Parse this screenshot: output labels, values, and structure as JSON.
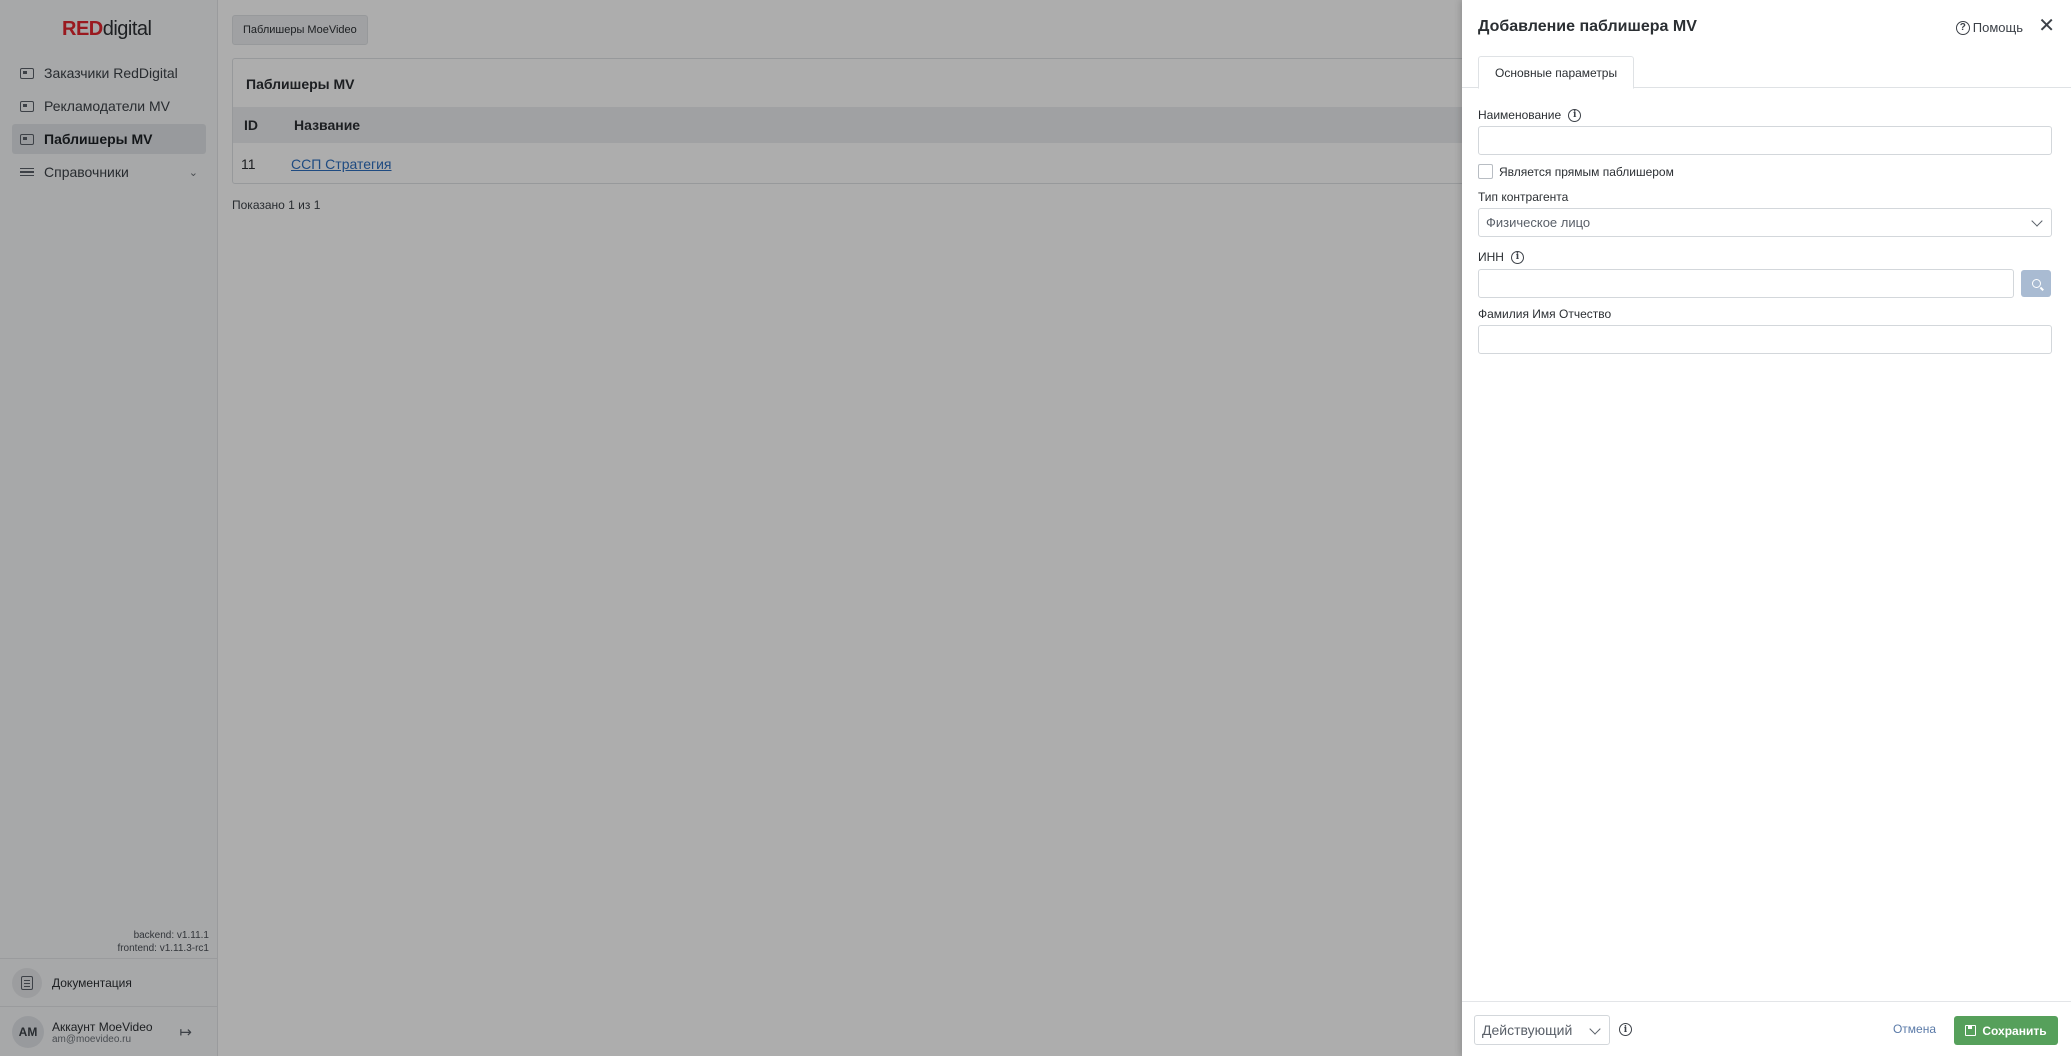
{
  "logo": {
    "red": "RED",
    "digital": "digital"
  },
  "sidebar": {
    "items": [
      {
        "label": "Заказчики RedDigital",
        "icon": "card-icon"
      },
      {
        "label": "Рекламодатели MV",
        "icon": "card-icon"
      },
      {
        "label": "Паблишеры MV",
        "icon": "card-icon",
        "active": true
      },
      {
        "label": "Справочники",
        "icon": "list-icon",
        "expandable": true
      }
    ],
    "versions": {
      "backend": "backend: v1.11.1",
      "frontend": "frontend: v1.11.3-rc1"
    },
    "docs_label": "Документация",
    "account": {
      "initials": "AM",
      "name": "Аккаунт MoeVideo",
      "email": "am@moevideo.ru"
    }
  },
  "main": {
    "breadcrumb": "Паблишеры MoeVideo",
    "card_title": "Паблишеры MV",
    "columns": {
      "id": "ID",
      "name": "Название"
    },
    "rows": [
      {
        "id": "11",
        "name": "ССП Стратегия"
      }
    ],
    "count_text": "Показано 1 из 1"
  },
  "drawer": {
    "title": "Добавление паблишера MV",
    "help_label": "Помощь",
    "close_glyph": "✕",
    "tab_label": "Основные параметры",
    "name_label": "Наименование",
    "name_value": "",
    "direct_checkbox_label": "Является прямым паблишером",
    "contractor_type_label": "Тип контрагента",
    "contractor_type_value": "Физическое лицо",
    "inn_label": "ИНН",
    "inn_value": "",
    "fio_label": "Фамилия Имя Отчество",
    "fio_value": "",
    "status_value": "Действующий",
    "cancel_label": "Отмена",
    "save_label": "Сохранить"
  },
  "colors": {
    "brand_red": "#e3262f",
    "link": "#2f6fbf",
    "save_green": "#56a05b",
    "search_button": "#a9bbd2"
  }
}
